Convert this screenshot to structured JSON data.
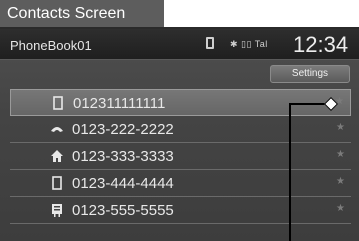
{
  "header": {
    "title": "Contacts Screen"
  },
  "status": {
    "device": "PhoneBook01",
    "indicators": "✱ ▯▯ Tal",
    "time": "12:34"
  },
  "buttons": {
    "settings": "Settings"
  },
  "contacts": [
    {
      "icon": "mobile-phone-icon",
      "number": "012311111111",
      "selected": true
    },
    {
      "icon": "home-phone-icon",
      "number": "0123-222-2222",
      "selected": false
    },
    {
      "icon": "house-icon",
      "number": "0123-333-3333",
      "selected": false
    },
    {
      "icon": "mobile-phone-icon",
      "number": "0123-444-4444",
      "selected": false
    },
    {
      "icon": "office-building-icon",
      "number": "0123-555-5555",
      "selected": false
    }
  ],
  "colors": {
    "header_bg": "#5d5d5d",
    "screen_bg": "#444444",
    "text": "#e8e8e8"
  }
}
